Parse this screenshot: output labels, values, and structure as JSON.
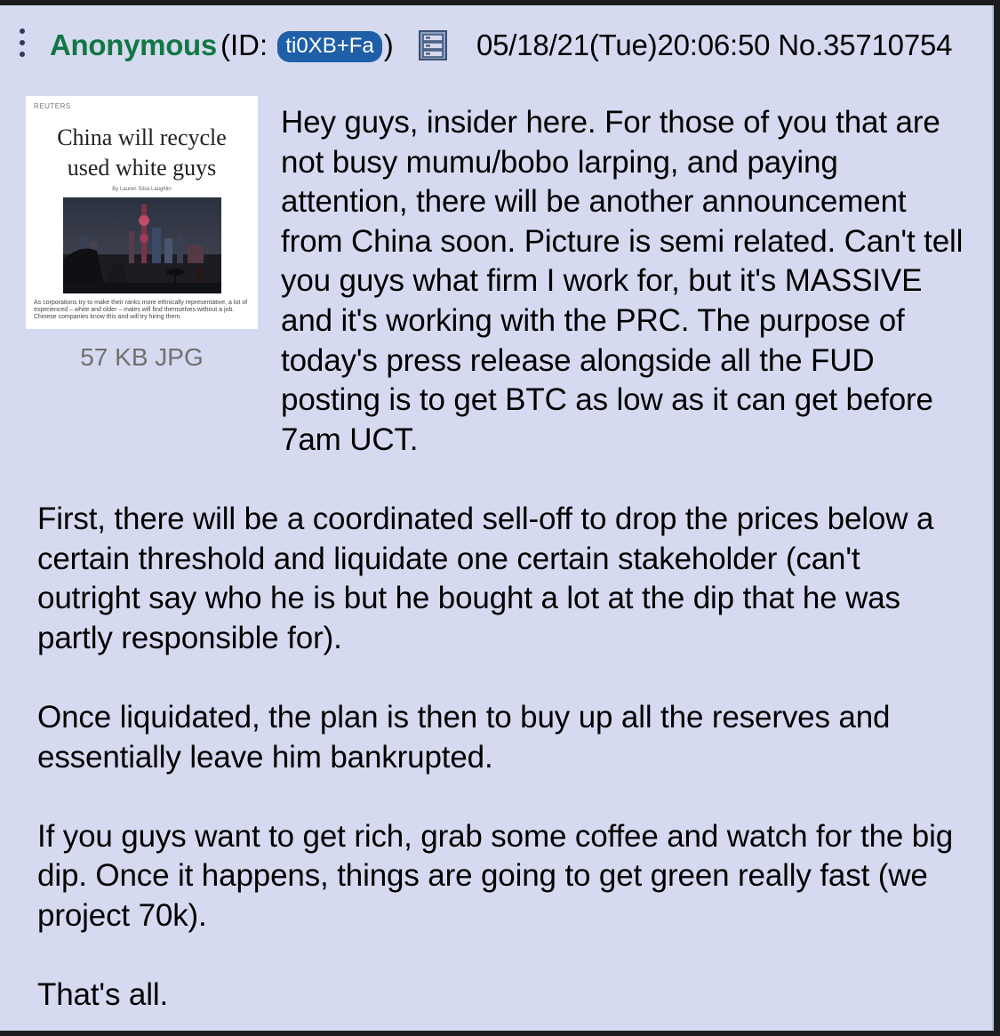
{
  "post": {
    "name": "Anonymous",
    "id_prefix": "(ID:",
    "id": "ti0XB+Fa",
    "id_suffix": ")",
    "datetime": "05/18/21(Tue)20:06:50",
    "post_number": "No.35710754",
    "flag_icon": "server-flag-icon",
    "menu_icon": "vertical-dots-menu-icon",
    "colors": {
      "background": "#d6daf0",
      "name": "#117743",
      "id_badge": "#1f5fa8",
      "file_info": "#707070"
    }
  },
  "attachment": {
    "file_info": "57 KB JPG",
    "thumbnail": {
      "source_mark": "REUTERS",
      "headline_line1": "China will recycle",
      "headline_line2": "used white guys",
      "byline": "By Lauren Silva Laughlin",
      "caption": "As corporations try to make their ranks more ethnically representative, a lot of experienced – white and older – males will find themselves without a job. Chinese companies know this and will try hiring them."
    }
  },
  "body": {
    "paragraphs": [
      "Hey guys, insider here. For those of you that are not busy mumu/bobo larping, and paying attention, there will be another announcement from China soon. Picture is semi related. Can't tell you guys what firm I work for, but it's MASSIVE and it's working with the PRC. The purpose of today's press release alongside all the FUD posting is to get BTC as low as it can get before 7am UCT.",
      "First, there will be a coordinated sell-off to drop the prices below a certain threshold and liquidate one certain stakeholder (can't outright say who he is but he bought a lot at the dip that he was partly responsible for).",
      "Once liquidated, the plan is then to buy up all the reserves and essentially leave him bankrupted.",
      "If you guys want to get rich, grab some coffee and watch for the big dip. Once it happens, things are going to get green really fast (we project 70k).",
      "That's all."
    ]
  }
}
